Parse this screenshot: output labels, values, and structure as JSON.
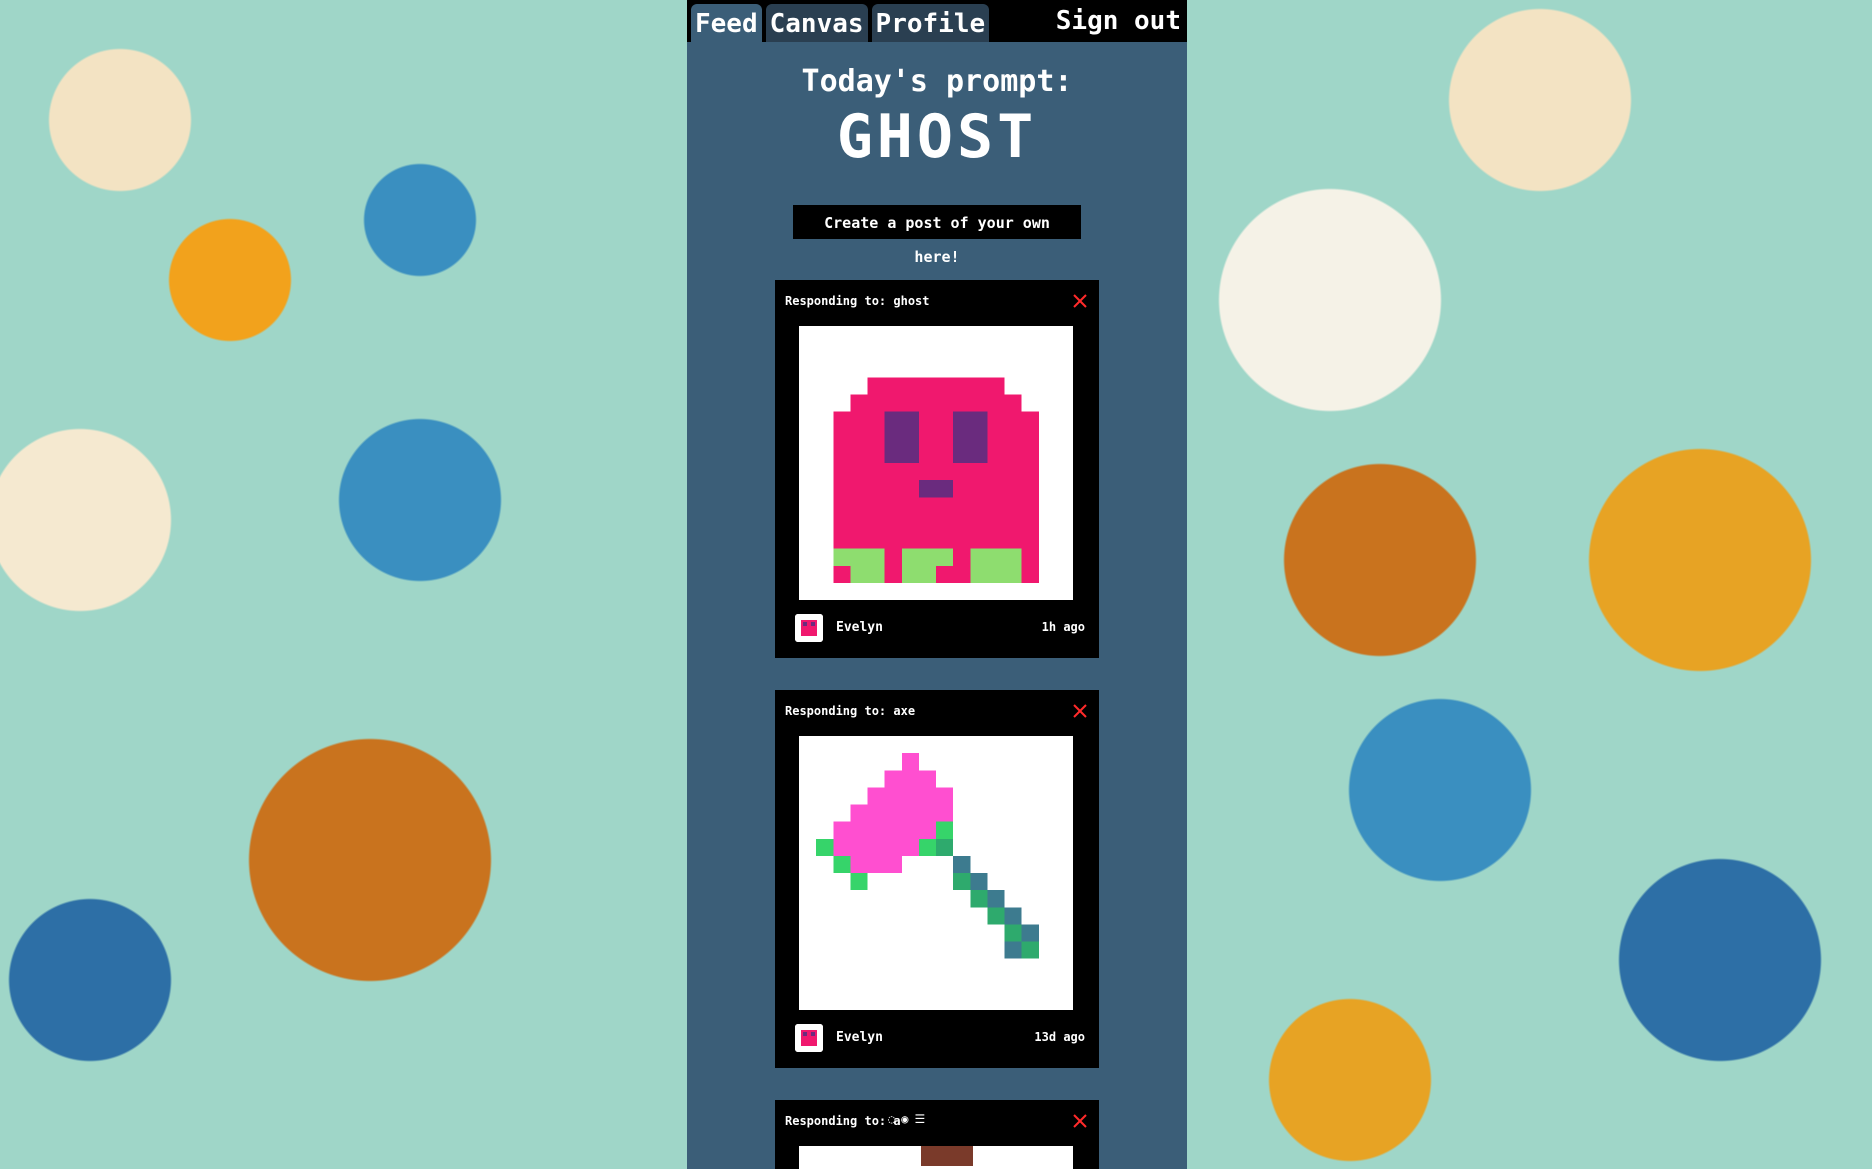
{
  "nav": {
    "tabs": [
      {
        "label": "Feed"
      },
      {
        "label": "Canvas"
      },
      {
        "label": "Profile"
      }
    ],
    "signout_label": "Sign out"
  },
  "prompt": {
    "label": "Today's prompt:",
    "word": "GHOST"
  },
  "create_button_label": "Create a post of your own here!",
  "posts": [
    {
      "responding": "Responding to: ghost",
      "username": "Evelyn",
      "time": "1h ago",
      "art": "ghost"
    },
    {
      "responding": "Responding to: axe",
      "username": "Evelyn",
      "time": "13d ago",
      "art": "axe"
    },
    {
      "responding": "Responding to: a",
      "username": "",
      "time": ""
    }
  ],
  "colors": {
    "panel": "#3b5e78",
    "ghost_body": "#f0186e",
    "ghost_eyes": "#6a2b7e",
    "ghost_feet": "#8edd6f",
    "axe_head": "#ff4fd0",
    "axe_handle": "#2eaa6d",
    "close_x": "#ff2a2a"
  }
}
